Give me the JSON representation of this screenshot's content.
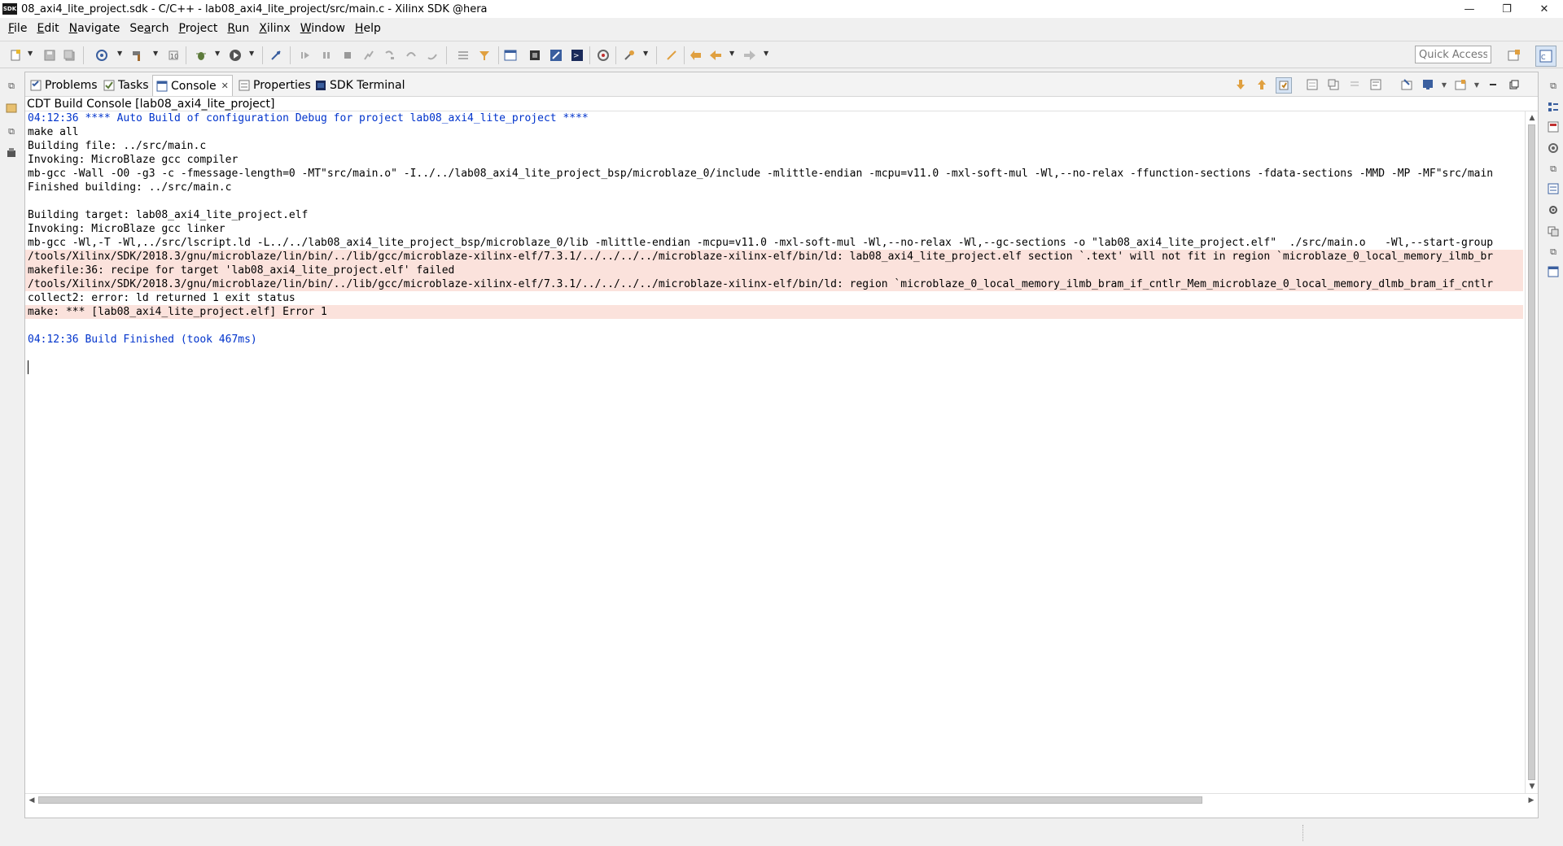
{
  "window": {
    "logo_text": "SDK",
    "title": "08_axi4_lite_project.sdk - C/C++ - lab08_axi4_lite_project/src/main.c - Xilinx SDK @hera",
    "minimize": "—",
    "restore": "❐",
    "close": "✕"
  },
  "menu": {
    "items": [
      {
        "mn": "F",
        "rest": "ile"
      },
      {
        "mn": "E",
        "rest": "dit"
      },
      {
        "mn": "N",
        "rest": "avigate"
      },
      {
        "mn": "",
        "rest": "Se",
        "mn2": "a",
        "rest2": "rch"
      },
      {
        "mn": "P",
        "rest": "roject"
      },
      {
        "mn": "R",
        "rest": "un"
      },
      {
        "mn": "X",
        "rest": "ilinx"
      },
      {
        "mn": "W",
        "rest": "indow"
      },
      {
        "mn": "H",
        "rest": "elp"
      }
    ]
  },
  "toolbar": {
    "quick_access_placeholder": "Quick Access"
  },
  "tabs": {
    "problems": "Problems",
    "tasks": "Tasks",
    "console": "Console",
    "properties": "Properties",
    "sdk_terminal": "SDK Terminal"
  },
  "console": {
    "title": "CDT Build Console [lab08_axi4_lite_project]",
    "lines": [
      {
        "text": "04:12:36 **** Auto Build of configuration Debug for project lab08_axi4_lite_project ****",
        "kind": "info"
      },
      {
        "text": "make all",
        "kind": "normal"
      },
      {
        "text": "Building file: ../src/main.c",
        "kind": "normal"
      },
      {
        "text": "Invoking: MicroBlaze gcc compiler",
        "kind": "normal"
      },
      {
        "text": "mb-gcc -Wall -O0 -g3 -c -fmessage-length=0 -MT\"src/main.o\" -I../../lab08_axi4_lite_project_bsp/microblaze_0/include -mlittle-endian -mcpu=v11.0 -mxl-soft-mul -Wl,--no-relax -ffunction-sections -fdata-sections -MMD -MP -MF\"src/main",
        "kind": "normal"
      },
      {
        "text": "Finished building: ../src/main.c",
        "kind": "normal"
      },
      {
        "text": "",
        "kind": "normal"
      },
      {
        "text": "Building target: lab08_axi4_lite_project.elf",
        "kind": "normal"
      },
      {
        "text": "Invoking: MicroBlaze gcc linker",
        "kind": "normal"
      },
      {
        "text": "mb-gcc -Wl,-T -Wl,../src/lscript.ld -L../../lab08_axi4_lite_project_bsp/microblaze_0/lib -mlittle-endian -mcpu=v11.0 -mxl-soft-mul -Wl,--no-relax -Wl,--gc-sections -o \"lab08_axi4_lite_project.elf\"  ./src/main.o   -Wl,--start-group",
        "kind": "normal"
      },
      {
        "text": "/tools/Xilinx/SDK/2018.3/gnu/microblaze/lin/bin/../lib/gcc/microblaze-xilinx-elf/7.3.1/../../../../microblaze-xilinx-elf/bin/ld: lab08_axi4_lite_project.elf section `.text' will not fit in region `microblaze_0_local_memory_ilmb_br",
        "kind": "err"
      },
      {
        "text": "makefile:36: recipe for target 'lab08_axi4_lite_project.elf' failed",
        "kind": "err"
      },
      {
        "text": "/tools/Xilinx/SDK/2018.3/gnu/microblaze/lin/bin/../lib/gcc/microblaze-xilinx-elf/7.3.1/../../../../microblaze-xilinx-elf/bin/ld: region `microblaze_0_local_memory_ilmb_bram_if_cntlr_Mem_microblaze_0_local_memory_dlmb_bram_if_cntlr",
        "kind": "err"
      },
      {
        "text": "collect2: error: ld returned 1 exit status",
        "kind": "normal"
      },
      {
        "text": "make: *** [lab08_axi4_lite_project.elf] Error 1",
        "kind": "err"
      },
      {
        "text": "",
        "kind": "normal"
      },
      {
        "text": "04:12:36 Build Finished (took 467ms)",
        "kind": "info"
      }
    ]
  },
  "colors": {
    "info_text": "#0033cc",
    "error_bg": "#fbe2dc"
  }
}
